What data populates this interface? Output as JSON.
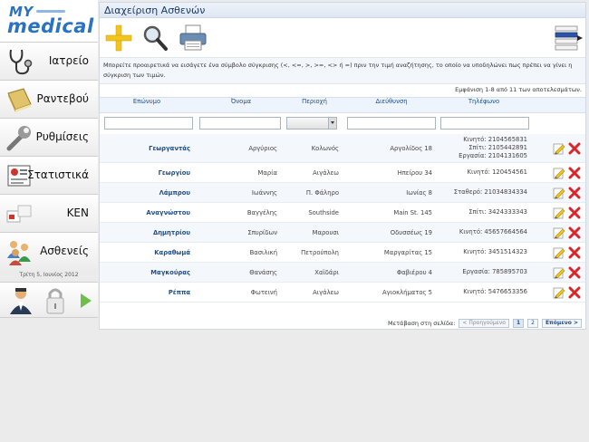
{
  "logo": {
    "line1": "MY",
    "line2": "medical"
  },
  "sidebar": {
    "items": [
      {
        "label": "Ιατρείο",
        "icon": "stethoscope-icon"
      },
      {
        "label": "Ραντεβού",
        "icon": "appointment-book-icon"
      },
      {
        "label": "Ρυθμίσεις",
        "icon": "wrench-icon"
      },
      {
        "label": "Στατιστικά",
        "icon": "statistics-chart-icon"
      },
      {
        "label": "ΚΕΝ",
        "icon": "ken-cards-icon"
      },
      {
        "label": "Ασθενείς",
        "icon": "patients-group-icon"
      }
    ],
    "date": "Τρίτη 5, Ιουνίος 2012"
  },
  "panel": {
    "title": "Διαχείριση Ασθενών",
    "hint": "Μπορείτε προαιρετικά να εισάγετε ένα σύμβολο σύγκρισης (<, <=, >, >=, <> ή =) πριν την τιμή αναζήτησης, το οποίο να υποδηλώνει πως πρέπει να γίνει η σύγκριση των τιμών.",
    "results_info": "Εμφάνιση 1-8 από 11 των αποτελεσμάτων."
  },
  "table": {
    "columns": [
      "Επώνυμο",
      "Όνομα",
      "Περιοχή",
      "Διεύθυνση",
      "Τηλέφωνο"
    ],
    "rows": [
      {
        "surname": "Γεωργαντάς",
        "name": "Αργύριος",
        "area": "Κολωνός",
        "address": "Αργολίδος 18",
        "phones": [
          "Κινητό: 2104565831",
          "Σπίτι: 2105442891",
          "Εργασία: 2104131605"
        ]
      },
      {
        "surname": "Γεωργίου",
        "name": "Μαρία",
        "area": "Αιγάλεω",
        "address": "Ηπείρου 34",
        "phones": [
          "Κινητό: 120454561"
        ]
      },
      {
        "surname": "Λάμπρου",
        "name": "Ιωάννης",
        "area": "Π. Φάληρο",
        "address": "Ιωνίας 8",
        "phones": [
          "Σταθερό: 21034834334"
        ]
      },
      {
        "surname": "Αναγνώστου",
        "name": "Βαγγέλης",
        "area": "Southside",
        "address": "Main St. 145",
        "phones": [
          "Σπίτι: 3424333343"
        ]
      },
      {
        "surname": "Δημητρίου",
        "name": "Σπυρίδων",
        "area": "Μαρουσι",
        "address": "Οδυσσέως 19",
        "phones": [
          "Κινητό: 45657664564"
        ]
      },
      {
        "surname": "Καραθωμά",
        "name": "Βασιλική",
        "area": "Πετρούπολη",
        "address": "Μαργαρίτας 15",
        "phones": [
          "Κινητό: 3451514323"
        ]
      },
      {
        "surname": "Μαγκούρας",
        "name": "Θανάσης",
        "area": "Χαϊδάρι",
        "address": "Φαβιέρου 4",
        "phones": [
          "Εργασία: 785895703"
        ]
      },
      {
        "surname": "Ρέππα",
        "name": "Φωτεινή",
        "area": "Αιγάλεω",
        "address": "Αγιοκλήματος 5",
        "phones": [
          "Κινητό: 5476653356"
        ]
      }
    ]
  },
  "pager": {
    "label": "Μετάβαση στη σελίδα:",
    "prev": "< Προηγούμενο",
    "pages": [
      "1",
      "2"
    ],
    "current": "1",
    "next": "Επόμενο >"
  },
  "colors": {
    "accent": "#2a72c2",
    "link": "#1d4e8c",
    "delete": "#d8262b",
    "add": "#f2c41c"
  }
}
